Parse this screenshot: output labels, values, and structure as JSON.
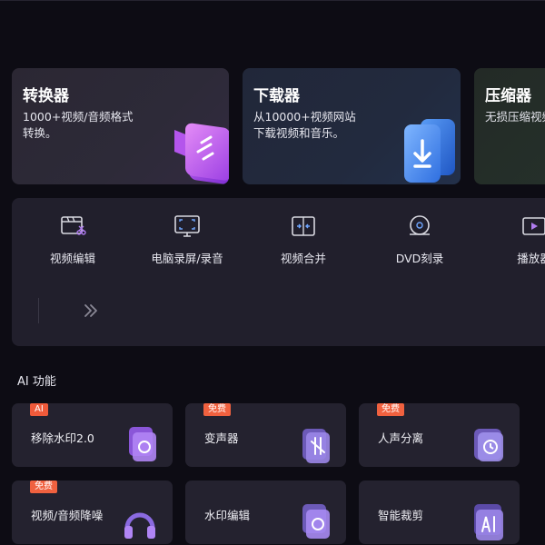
{
  "cards": [
    {
      "title": "转换器",
      "desc": "1000+视频/音频格式转换。"
    },
    {
      "title": "下载器",
      "desc": "从10000+视频网站下载视频和音乐。"
    },
    {
      "title": "压缩器",
      "desc": "无损压缩视频文件。"
    }
  ],
  "tools": [
    {
      "label": "视频编辑",
      "icon": "video-edit-icon"
    },
    {
      "label": "电脑录屏/录音",
      "icon": "screen-record-icon"
    },
    {
      "label": "视频合并",
      "icon": "video-merge-icon"
    },
    {
      "label": "DVD刻录",
      "icon": "dvd-burn-icon"
    },
    {
      "label": "播放器",
      "icon": "player-icon"
    }
  ],
  "ai_section": {
    "title": "AI 功能",
    "items": [
      {
        "label": "移除水印2.0",
        "badge": "AI"
      },
      {
        "label": "变声器",
        "badge": "免费"
      },
      {
        "label": "人声分离",
        "badge": "免费"
      },
      {
        "label": "视频/音频降噪",
        "badge": "免费"
      },
      {
        "label": "水印编辑",
        "badge": ""
      },
      {
        "label": "智能裁剪",
        "badge": ""
      }
    ]
  },
  "colors": {
    "background": "#0d0c14",
    "panel": "#211f2c",
    "badge": "#f0613f",
    "accent_purple": "#c05cf0",
    "accent_blue": "#4a8ff0"
  }
}
